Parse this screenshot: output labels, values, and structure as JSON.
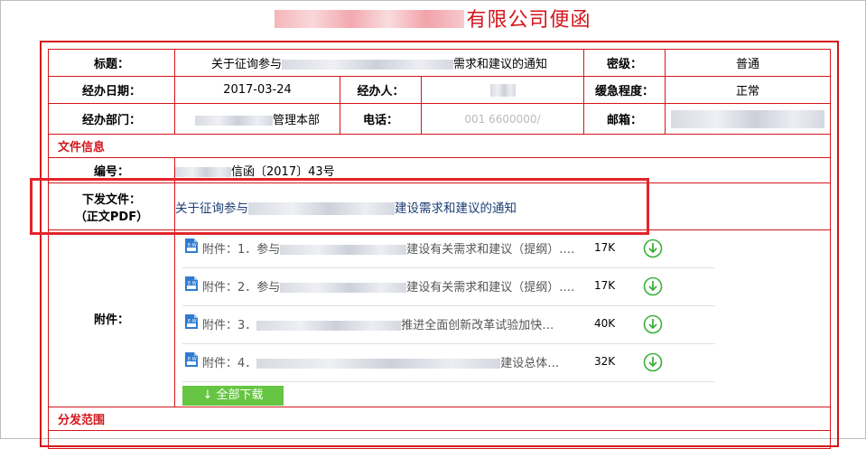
{
  "header": {
    "title_suffix": "有限公司便函"
  },
  "info": {
    "title_label": "标题：",
    "title_prefix": "关于征询参与",
    "title_suffix": "需求和建议的通知",
    "secret_label": "密级：",
    "secret_value": "普通",
    "date_label": "经办日期：",
    "date_value": "2017-03-24",
    "handler_label": "经办人：",
    "urgency_label": "缓急程度：",
    "urgency_value": "正常",
    "dept_label": "经办部门：",
    "dept_suffix": "管理本部",
    "phone_label": "电话：",
    "phone_partial": "001 6600000/",
    "email_label": "邮箱："
  },
  "file_info": {
    "section_label": "文件信息",
    "number_label": "编号：",
    "number_suffix": "信函〔2017〕43号",
    "issued_label_line1": "下发文件：",
    "issued_label_line2": "（正文PDF）",
    "issued_prefix": "关于征询参与",
    "issued_suffix": "建设需求和建议的通知"
  },
  "attachments": {
    "label": "附件：",
    "items": [
      {
        "prefix": "附件：1．参与",
        "suffix": "建设有关需求和建议（提纲）.…",
        "size": "17K"
      },
      {
        "prefix": "附件：2．参与",
        "suffix": "建设有关需求和建议（提纲）.…",
        "size": "17K"
      },
      {
        "prefix": "附件：3．",
        "suffix": "推进全面创新改革试验加快…",
        "size": "40K"
      },
      {
        "prefix": "附件：4．",
        "suffix": "建设总体…",
        "size": "32K"
      }
    ],
    "download_all": "↓ 全部下载"
  },
  "distribution": {
    "section_label": "分发范围"
  },
  "colors": {
    "accent_red": "#d4151b",
    "download_green": "#66c542",
    "link_blue": "#1c3d73"
  },
  "icons": [
    "word-file-icon",
    "download-circle-icon"
  ]
}
